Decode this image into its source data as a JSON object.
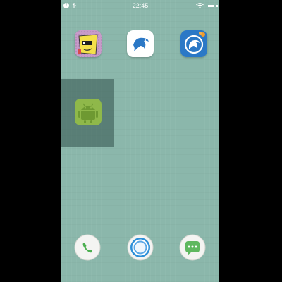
{
  "status_bar": {
    "time": "22:45",
    "icons": [
      "info-icon",
      "usb-icon",
      "wifi-icon",
      "battery-icon"
    ],
    "battery_level": 0.85
  },
  "home_screen": {
    "apps": [
      {
        "id": "cartoon-app",
        "icon": "cartoon-face-icon"
      },
      {
        "id": "dolphin-browser",
        "icon": "dolphin-icon"
      },
      {
        "id": "dolphin-browser-alt",
        "icon": "dolphin-blue-icon"
      },
      {
        "id": "android-app",
        "icon": "android-robot-icon",
        "highlighted": true
      }
    ]
  },
  "dock": {
    "items": [
      {
        "id": "phone",
        "icon": "phone-icon"
      },
      {
        "id": "home",
        "icon": "home-circle-icon"
      },
      {
        "id": "messages",
        "icon": "chat-bubble-icon"
      }
    ]
  },
  "colors": {
    "wallpaper": "#8bb7ab",
    "android_green": "#8fb84a",
    "dolphin_blue": "#2b78c6",
    "phone_green": "#4caf50"
  }
}
